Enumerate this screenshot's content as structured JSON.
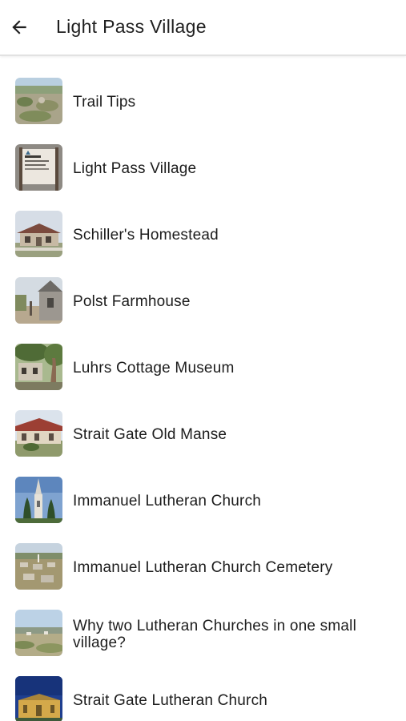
{
  "header": {
    "title": "Light Pass Village",
    "back_icon": "arrow-left-icon"
  },
  "items": [
    {
      "label": "Trail Tips",
      "thumb": "garden-scene"
    },
    {
      "label": "Light Pass Village",
      "thumb": "village-sign"
    },
    {
      "label": "Schiller's Homestead",
      "thumb": "homestead"
    },
    {
      "label": "Polst Farmhouse",
      "thumb": "farmhouse"
    },
    {
      "label": "Luhrs Cottage Museum",
      "thumb": "cottage"
    },
    {
      "label": "Strait Gate Old Manse",
      "thumb": "manse"
    },
    {
      "label": "Immanuel Lutheran Church",
      "thumb": "church-steeple"
    },
    {
      "label": "Immanuel Lutheran Church Cemetery",
      "thumb": "cemetery"
    },
    {
      "label": "Why two Lutheran Churches in one small village?",
      "thumb": "landscape"
    },
    {
      "label": "Strait Gate Lutheran Church",
      "thumb": "church-building"
    }
  ]
}
